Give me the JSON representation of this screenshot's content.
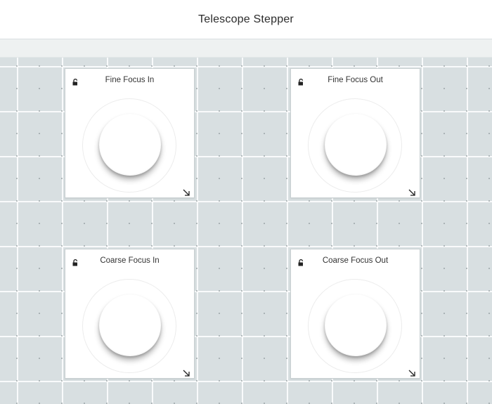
{
  "app": {
    "title": "Telescope Stepper"
  },
  "widgets": [
    {
      "label": "Fine Focus In",
      "lock_icon": "unlock-icon",
      "resize_icon": "resize-handle-icon"
    },
    {
      "label": "Fine Focus Out",
      "lock_icon": "unlock-icon",
      "resize_icon": "resize-handle-icon"
    },
    {
      "label": "Coarse Focus In",
      "lock_icon": "unlock-icon",
      "resize_icon": "resize-handle-icon"
    },
    {
      "label": "Coarse Focus Out",
      "lock_icon": "unlock-icon",
      "resize_icon": "resize-handle-icon"
    }
  ],
  "colors": {
    "background": "#dde3e5",
    "panel": "#ffffff",
    "text": "#333333"
  }
}
